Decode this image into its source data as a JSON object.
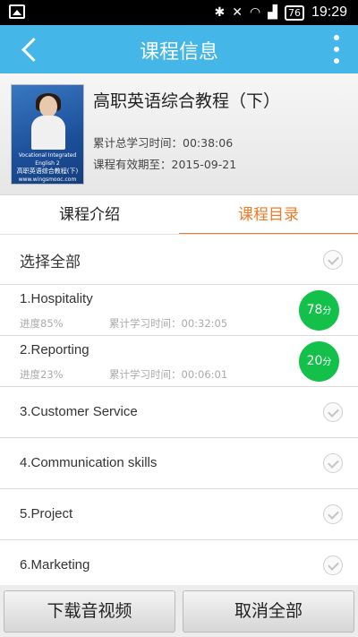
{
  "status_bar": {
    "time": "19:29",
    "battery": "76",
    "icons": [
      "image-icon",
      "bluetooth-icon",
      "mute-icon",
      "wifi-icon",
      "signal-icon",
      "battery-icon"
    ]
  },
  "header": {
    "title": "课程信息",
    "back_icon": "back-arrow-icon",
    "menu_icon": "more-vertical-icon",
    "color": "#44b7e8"
  },
  "course": {
    "title": "高职英语综合教程（下）",
    "total_time_label": "累计总学习时间：00:38:06",
    "valid_until_label": "课程有效期至：2015-09-21",
    "cover": {
      "line1": "Vocational Integrated English 2",
      "line2": "高职英语综合教程(下)",
      "line3": "www.wingsmooc.com"
    }
  },
  "tabs": [
    {
      "label": "课程介绍",
      "active": false
    },
    {
      "label": "课程目录",
      "active": true
    }
  ],
  "accent_color": "#f07a26",
  "list": {
    "select_all": "选择全部",
    "items": [
      {
        "label": "1.Hospitality",
        "progress": "进度85%",
        "study_time": "累计学习时间：00:32:05",
        "score": "78",
        "score_unit": "分"
      },
      {
        "label": "2.Reporting",
        "progress": "进度23%",
        "study_time": "累计学习时间：00:06:01",
        "score": "20",
        "score_unit": "分"
      },
      {
        "label": "3.Customer Service"
      },
      {
        "label": "4.Communication skills"
      },
      {
        "label": "5.Project"
      },
      {
        "label": "6.Marketing"
      }
    ]
  },
  "score_color": "#13c14a",
  "buttons": {
    "download": "下载音视频",
    "cancel_all": "取消全部"
  }
}
